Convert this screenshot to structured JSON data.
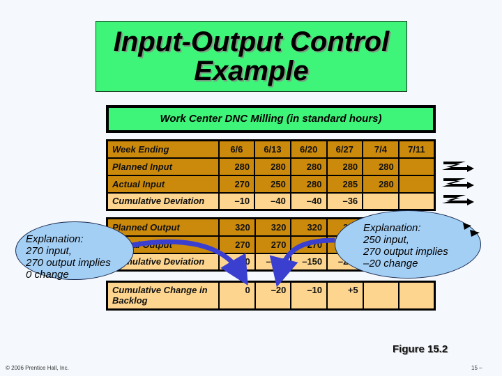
{
  "title": {
    "line1": "Input-Output Control",
    "line2": "Example"
  },
  "subtitle": "Work Center DNC Milling (in standard hours)",
  "colors": {
    "title_bg": "#3ef57a",
    "header_row_bg": "#cc8a0c",
    "deviation_row_bg": "#fdd58e",
    "bubble_bg": "#a4cff5",
    "curved_arrow": "#3a3fd0"
  },
  "input_table": {
    "header": {
      "label": "Week Ending",
      "weeks": [
        "6/6",
        "6/13",
        "6/20",
        "6/27",
        "7/4",
        "7/11"
      ]
    },
    "rows": [
      {
        "label": "Planned Input",
        "values": [
          "280",
          "280",
          "280",
          "280",
          "280",
          ""
        ]
      },
      {
        "label": "Actual Input",
        "values": [
          "270",
          "250",
          "280",
          "285",
          "280",
          ""
        ]
      },
      {
        "label": "Cumulative Deviation",
        "values": [
          "–10",
          "–40",
          "–40",
          "–36",
          "",
          ""
        ]
      }
    ]
  },
  "output_table": {
    "rows": [
      {
        "label": "Planned Output",
        "values": [
          "320",
          "320",
          "320",
          "320",
          "",
          ""
        ]
      },
      {
        "label": "Actual Output",
        "values": [
          "270",
          "270",
          "270",
          "",
          "",
          ""
        ]
      },
      {
        "label": "Cumulative Deviation",
        "values": [
          "–50",
          "–100",
          "–150",
          "–200",
          "",
          ""
        ]
      }
    ]
  },
  "backlog_table": {
    "rows": [
      {
        "label": "Cumulative Change in Backlog",
        "values": [
          "0",
          "–20",
          "–10",
          "+5",
          "",
          ""
        ]
      }
    ]
  },
  "explanations": {
    "left": {
      "heading": "Explanation:",
      "lines": [
        "270 input,",
        "270 output implies",
        "0 change"
      ]
    },
    "right": {
      "heading": "Explanation:",
      "lines": [
        "250 input,",
        "270 output implies",
        "–20 change"
      ]
    }
  },
  "figure_label": "Figure 15.2",
  "footer": {
    "copyright": "© 2006 Prentice Hall, Inc.",
    "page": "15 –"
  }
}
